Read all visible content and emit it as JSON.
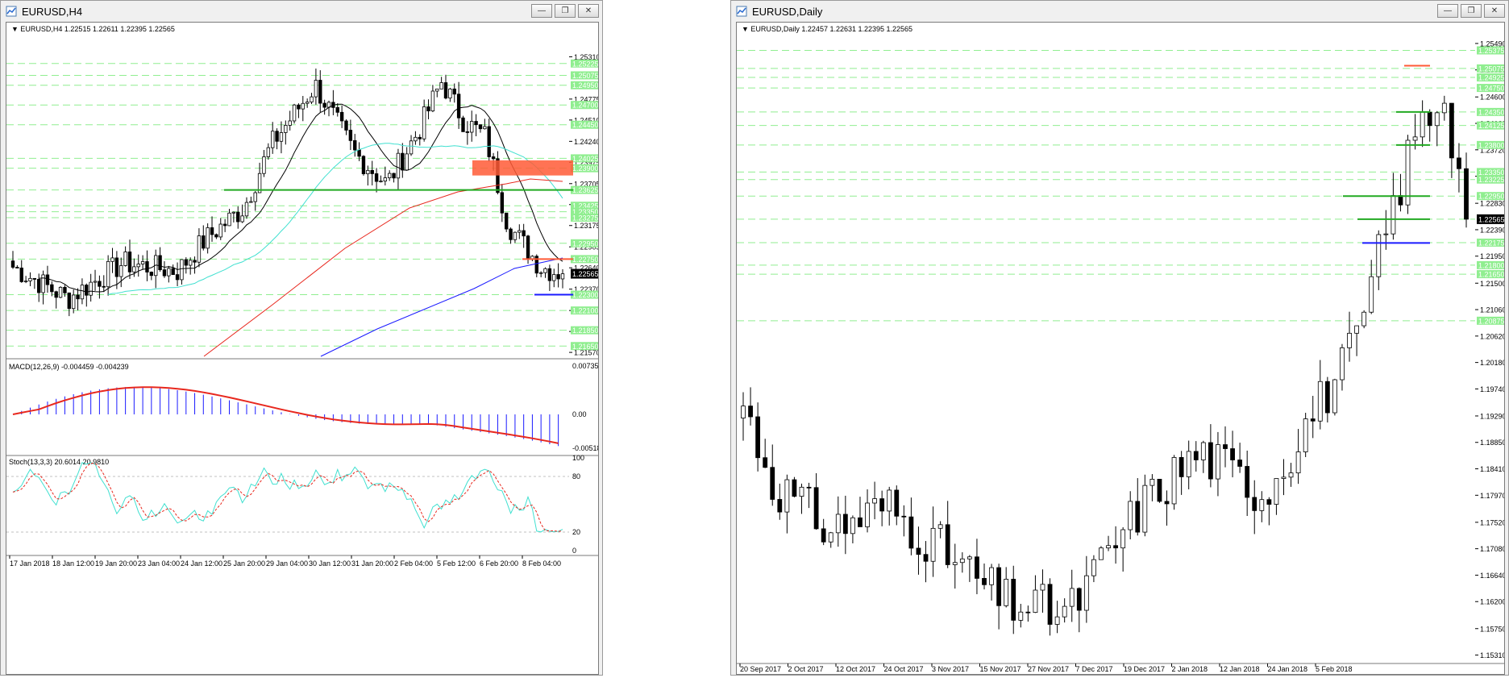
{
  "colors": {
    "bull": "#ffffff",
    "bear": "#000000",
    "grid": "#c0c0c0",
    "level_line": "#90ee90",
    "level_label_bg": "#90ee90",
    "ma_black": "#000000",
    "ma_cyan": "#40e0d0",
    "ma_red": "#e8281e",
    "ma_blue": "#1a1aff",
    "support_blue": "#1a1aff",
    "zone_green": "#22aa22",
    "zone_red": "#ff5a36"
  },
  "h4_window": {
    "title": "EURUSD,H4",
    "ohlc_label": "EURUSD,H4  1.22515 1.22611 1.22395 1.22565",
    "current_price": "1.22565",
    "macd_label": "MACD(12,26,9) -0.004459 -0.004239",
    "macd_scale": [
      "0.007355",
      "0.00",
      "-0.005186"
    ],
    "stoch_label": "Stoch(13,3,3) 20.6014 20.9810",
    "stoch_scale": [
      "100",
      "80",
      "20",
      "0"
    ],
    "price_scale": [
      "1.25310",
      "1.24775",
      "1.24510",
      "1.24240",
      "1.23975",
      "1.23705",
      "1.23440",
      "1.23175",
      "1.22905",
      "1.22640",
      "1.22370",
      "1.22100",
      "1.21835",
      "1.21570"
    ],
    "level_labels": [
      "1.25225",
      "1.25075",
      "1.24950",
      "1.24700",
      "1.24450",
      "1.24025",
      "1.23900",
      "1.23625",
      "1.23425",
      "1.23350",
      "1.23275",
      "1.22950",
      "1.22750",
      "1.22300",
      "1.22100",
      "1.21850",
      "1.21650"
    ],
    "time_labels": [
      "17 Jan 2018",
      "18 Jan 12:00",
      "19 Jan 20:00",
      "23 Jan 04:00",
      "24 Jan 12:00",
      "25 Jan 20:00",
      "29 Jan 04:00",
      "30 Jan 12:00",
      "31 Jan 20:00",
      "2 Feb 04:00",
      "5 Feb 12:00",
      "6 Feb 20:00",
      "8 Feb 04:00"
    ]
  },
  "daily_window": {
    "title": "EURUSD,Daily",
    "ohlc_label": "EURUSD,Daily  1.22457 1.22631 1.22395 1.22565",
    "current_price": "1.22565",
    "price_scale": [
      "1.25490",
      "1.25050",
      "1.24600",
      "1.24160",
      "1.23720",
      "1.23280",
      "1.22830",
      "1.22390",
      "1.21950",
      "1.21500",
      "1.21060",
      "1.20620",
      "1.20180",
      "1.19740",
      "1.19290",
      "1.18850",
      "1.18410",
      "1.17970",
      "1.17520",
      "1.17080",
      "1.16640",
      "1.16200",
      "1.15750",
      "1.15310"
    ],
    "level_labels": [
      "1.25375",
      "1.25075",
      "1.24925",
      "1.24750",
      "1.24350",
      "1.24125",
      "1.23800",
      "1.23350",
      "1.23225",
      "1.22950",
      "1.22565",
      "1.22175",
      "1.21800",
      "1.21650",
      "1.20875"
    ],
    "time_labels": [
      "20 Sep 2017",
      "2 Oct 2017",
      "12 Oct 2017",
      "24 Oct 2017",
      "3 Nov 2017",
      "15 Nov 2017",
      "27 Nov 2017",
      "7 Dec 2017",
      "19 Dec 2017",
      "2 Jan 2018",
      "12 Jan 2018",
      "24 Jan 2018",
      "5 Feb 2018"
    ]
  }
}
